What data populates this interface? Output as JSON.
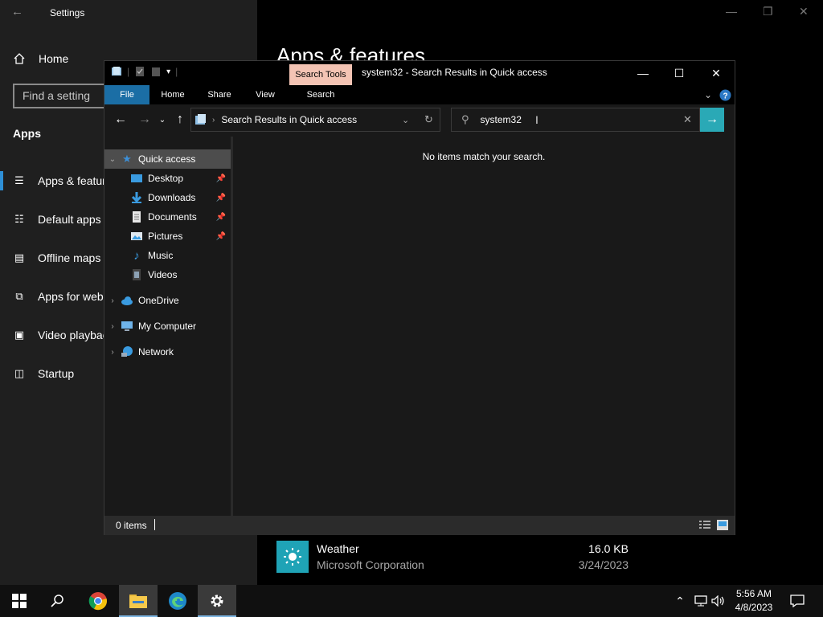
{
  "settings": {
    "title": "Settings",
    "home_label": "Home",
    "search_placeholder": "Find a setting",
    "section": "Apps",
    "nav": [
      {
        "label": "Apps & features"
      },
      {
        "label": "Default apps"
      },
      {
        "label": "Offline maps"
      },
      {
        "label": "Apps for websites"
      },
      {
        "label": "Video playback"
      },
      {
        "label": "Startup"
      }
    ],
    "main_title": "Apps & features",
    "app_entry": {
      "name": "Weather",
      "publisher": "Microsoft Corporation",
      "size": "16.0 KB",
      "date": "3/24/2023"
    }
  },
  "explorer": {
    "contextual_tab": "Search Tools",
    "title": "system32 - Search Results in Quick access",
    "ribbon_tabs": [
      "File",
      "Home",
      "Share",
      "View",
      "Search"
    ],
    "address": "Search Results in Quick access",
    "search_value": "system32",
    "empty_message": "No items match your search.",
    "status_count": "0 items",
    "nav": {
      "quick_access": "Quick access",
      "items": [
        {
          "label": "Desktop",
          "pinned": true
        },
        {
          "label": "Downloads",
          "pinned": true
        },
        {
          "label": "Documents",
          "pinned": true
        },
        {
          "label": "Pictures",
          "pinned": true
        },
        {
          "label": "Music",
          "pinned": false
        },
        {
          "label": "Videos",
          "pinned": false
        }
      ],
      "onedrive": "OneDrive",
      "computer": "My Computer",
      "network": "Network"
    }
  },
  "taskbar": {
    "time": "5:56 AM",
    "date": "4/8/2023"
  },
  "colors": {
    "accent": "#2e8fd6",
    "search_tools_tab": "#f4c4b4",
    "file_tab": "#1b6ea5",
    "search_go": "#2aa9b6",
    "weather_tile": "#1fa3b6"
  }
}
